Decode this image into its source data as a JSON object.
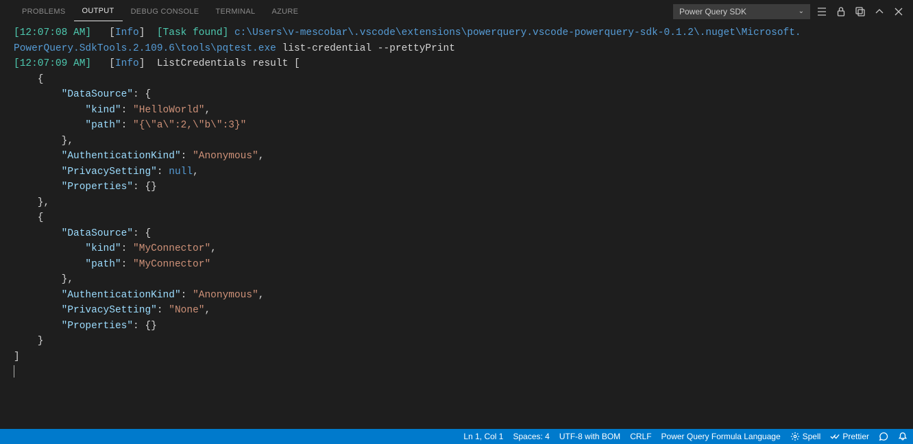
{
  "tabs": {
    "problems": "PROBLEMS",
    "output": "OUTPUT",
    "debug": "DEBUG CONSOLE",
    "terminal": "TERMINAL",
    "azure": "AZURE"
  },
  "dropdown": {
    "selected": "Power Query SDK"
  },
  "log": {
    "line1": {
      "ts": "[12:07:08 AM]",
      "level": "Info",
      "task": "[Task found]",
      "path1": "c:\\Users\\v-mescobar\\.vscode\\extensions\\powerquery.vscode-powerquery-sdk-0.1.2\\.nuget\\Microsoft.",
      "path2": "PowerQuery.SdkTools.2.109.6\\tools\\pqtest.exe",
      "args": " list-credential --prettyPrint"
    },
    "line2": {
      "ts": "[12:07:09 AM]",
      "level": "Info",
      "msg": "ListCredentials result ["
    },
    "json": {
      "ds_label": "\"DataSource\"",
      "kind_label": "\"kind\"",
      "path_label": "\"path\"",
      "auth_label": "\"AuthenticationKind\"",
      "privacy_label": "\"PrivacySetting\"",
      "props_label": "\"Properties\"",
      "obj1": {
        "kind": "\"HelloWorld\"",
        "path": "\"{\\\"a\\\":2,\\\"b\\\":3}\"",
        "auth": "\"Anonymous\"",
        "privacy": "null"
      },
      "obj2": {
        "kind": "\"MyConnector\"",
        "path": "\"MyConnector\"",
        "auth": "\"Anonymous\"",
        "privacy": "\"None\""
      }
    }
  },
  "status": {
    "pos": "Ln 1, Col 1",
    "spaces": "Spaces: 4",
    "enc": "UTF-8 with BOM",
    "eol": "CRLF",
    "lang": "Power Query Formula Language",
    "spell": "Spell",
    "prettier": "Prettier"
  }
}
